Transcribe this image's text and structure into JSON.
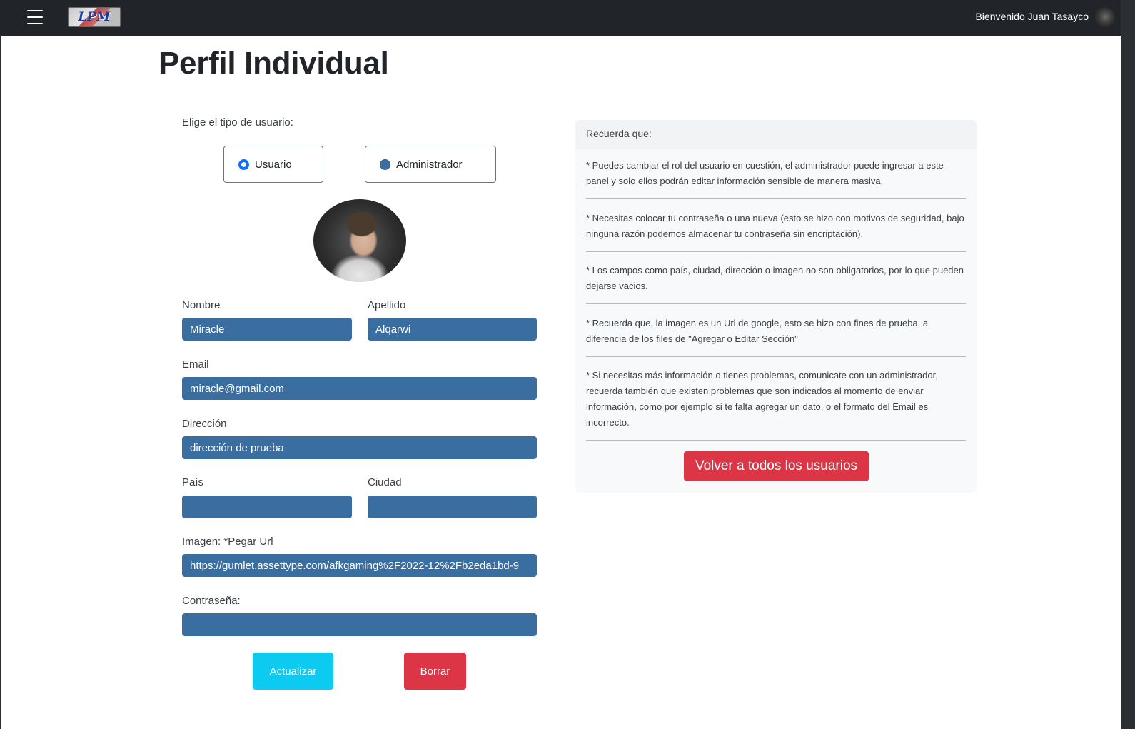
{
  "navbar": {
    "menu_icon": "hamburger-menu-icon",
    "logo_text": "LPM",
    "welcome_text": "Bienvenido Juan Tasayco"
  },
  "page": {
    "title": "Perfil Individual"
  },
  "form": {
    "user_type_label": "Elige el tipo de usuario:",
    "radio_options": [
      {
        "label": "Usuario",
        "checked": true
      },
      {
        "label": "Administrador",
        "checked": false
      }
    ],
    "fields": {
      "nombre": {
        "label": "Nombre",
        "value": "Miracle"
      },
      "apellido": {
        "label": "Apellido",
        "value": "Alqarwi"
      },
      "email": {
        "label": "Email",
        "value": "miracle@gmail.com"
      },
      "direccion": {
        "label": "Dirección",
        "value": "dirección de prueba"
      },
      "pais": {
        "label": "País",
        "value": ""
      },
      "ciudad": {
        "label": "Ciudad",
        "value": ""
      },
      "imagen": {
        "label": "Imagen: *Pegar Url",
        "value": "https://gumlet.assettype.com/afkgaming%2F2022-12%2Fb2eda1bd-9"
      },
      "contrasena": {
        "label": "Contraseña:",
        "value": ""
      }
    },
    "update_button": "Actualizar",
    "delete_button": "Borrar"
  },
  "info_panel": {
    "header": "Recuerda que:",
    "notes": [
      "* Puedes cambiar el rol del usuario en cuestión, el administrador puede ingresar a este panel y solo ellos podrán editar información sensible de manera masiva.",
      "* Necesitas colocar tu contraseña o una nueva (esto se hizo con motivos de seguridad, bajo ninguna razón podemos almacenar tu contraseña sin encriptación).",
      "* Los campos como país, ciudad, dirección o imagen no son obligatorios, por lo que pueden dejarse vacios.",
      "* Recuerda que, la imagen es un Url de google, esto se hizo con fines de prueba, a diferencia de los files de \"Agregar o Editar Sección\"",
      "* Si necesitas más información o tienes problemas, comunicate con un administrador, recuerda también que existen problemas que son indicados al momento de enviar información, como por ejemplo si te falta agregar un dato, o el formato del Email es incorrecto."
    ],
    "back_button": "Volver a todos los usuarios"
  },
  "colors": {
    "navbar_bg": "#212529",
    "field_bg": "#3b6ea0",
    "primary": "#0d6efd",
    "info": "#0dcaf0",
    "danger": "#dc3545",
    "panel_bg": "#f8f9fa"
  }
}
